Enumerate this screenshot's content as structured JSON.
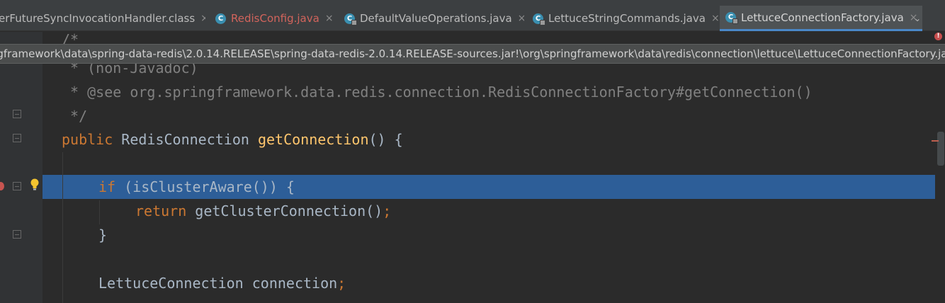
{
  "tabs": [
    {
      "label": "erFutureSyncInvocationHandler.class",
      "icon": "class-file-icon",
      "active": false,
      "color": "default"
    },
    {
      "label": "RedisConfig.java",
      "icon": "class-icon",
      "active": false,
      "color": "red"
    },
    {
      "label": "DefaultValueOperations.java",
      "icon": "class-locked-icon",
      "active": false,
      "color": "default"
    },
    {
      "label": "LettuceStringCommands.java",
      "icon": "class-locked-icon",
      "active": false,
      "color": "default"
    },
    {
      "label": "LettuceConnectionFactory.java",
      "icon": "class-locked-icon",
      "active": true,
      "color": "default"
    }
  ],
  "tab_close_glyph": "×",
  "tab_icon_letter": "C",
  "tab_more_glyph": "⌄",
  "path_tooltip": "pringframework\\data\\spring-data-redis\\2.0.14.RELEASE\\spring-data-redis-2.0.14.RELEASE-sources.jar!\\org\\springframework\\data\\redis\\connection\\lettuce\\LettuceConnectionFactory.java",
  "code": {
    "comment_open": "/*",
    "comment_nonjavadoc": " * (non-Javadoc)",
    "comment_see": " * @see org.springframework.data.redis.connection.RedisConnectionFactory#getConnection()",
    "comment_close": " */",
    "kw_public": "public",
    "type_ret": " RedisConnection ",
    "method_name": "getConnection",
    "method_tail": "() {",
    "kw_if": "if",
    "if_tail": " (isClusterAware()) {",
    "kw_return": "return",
    "return_tail": " getClusterConnection()",
    "semi": ";",
    "close_brace": "}",
    "decl": "LettuceConnection connection",
    "decl_semi": ";"
  },
  "error_indicator": "!",
  "colors": {
    "background": "#2b2b2b",
    "keyword": "#cc7832",
    "function": "#ffc66d",
    "comment": "#808080",
    "text": "#a9b7c6",
    "selection": "#2d5e98",
    "active_tab_underline": "#4a88c7"
  }
}
